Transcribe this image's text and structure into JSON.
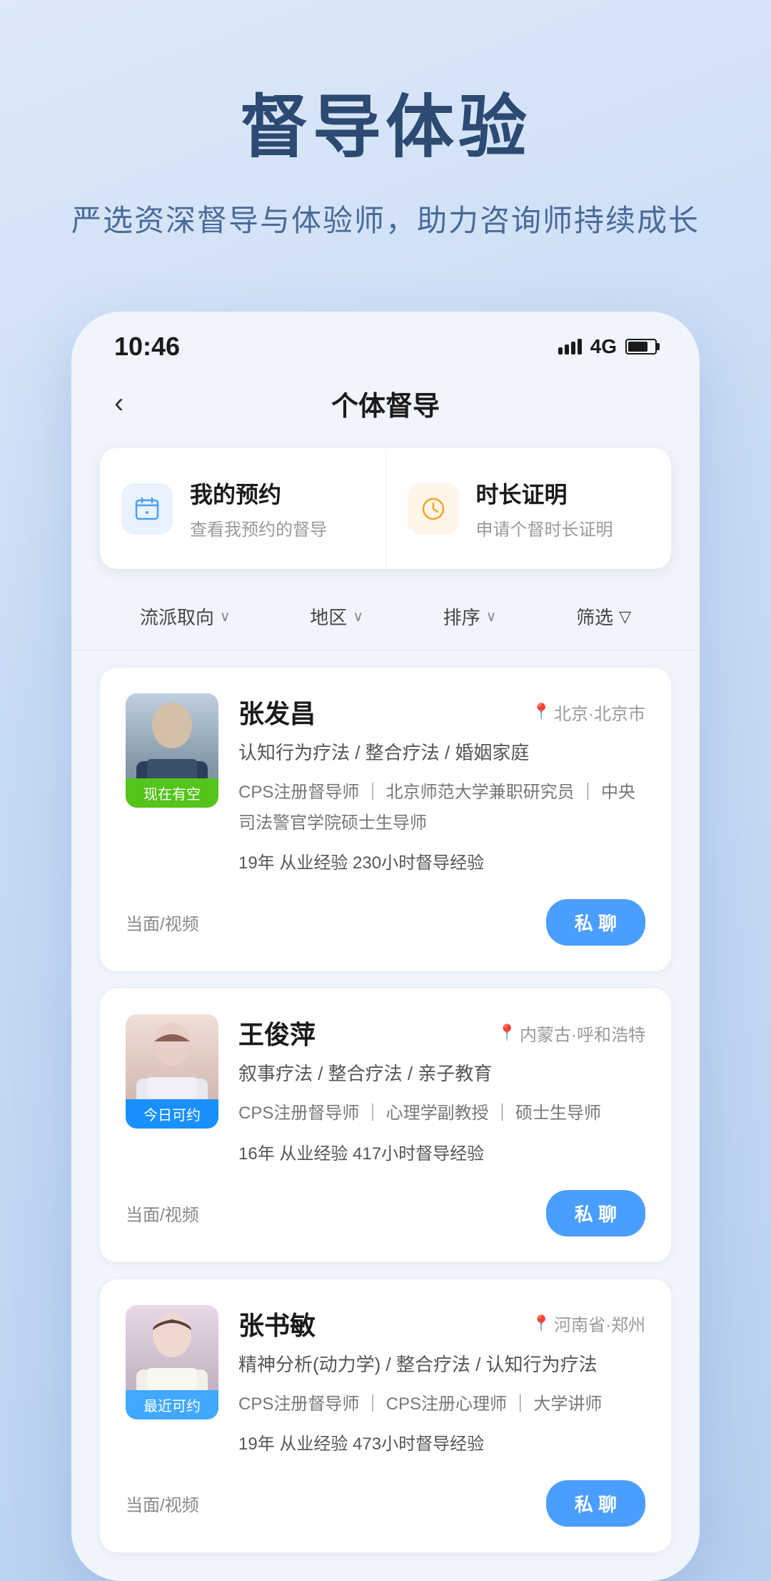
{
  "hero": {
    "title": "督导体验",
    "subtitle": "严选资深督导与体验师，助力咨询师持续成长"
  },
  "statusBar": {
    "time": "10:46",
    "signal": "4G",
    "battery": "75"
  },
  "navBar": {
    "backLabel": "‹",
    "title": "个体督导"
  },
  "actionCards": [
    {
      "id": "my-appointment",
      "icon": "📅",
      "iconType": "blue",
      "title": "我的预约",
      "desc": "查看我预约的督导"
    },
    {
      "id": "duration-cert",
      "icon": "🕐",
      "iconType": "orange",
      "title": "时长证明",
      "desc": "申请个督时长证明"
    }
  ],
  "filters": [
    {
      "label": "流派取向",
      "arrow": "∨"
    },
    {
      "label": "地区",
      "arrow": "∨"
    },
    {
      "label": "排序",
      "arrow": "∨"
    },
    {
      "label": "筛选",
      "icon": "▽"
    }
  ],
  "supervisors": [
    {
      "name": "张发昌",
      "location": "北京·北京市",
      "badge": "现在有空",
      "badgeColor": "badge-green",
      "tags": "认知行为疗法 / 整合疗法 / 婚姻家庭",
      "certs": "CPS注册督导师 ｜ 北京师范大学兼职研究员 ｜ 中央司法警官学院硕士生导师",
      "experience": "19年 从业经验   230小时督导经验",
      "mode": "当面/视频",
      "chatLabel": "私 聊",
      "avatarColor": "#8899aa"
    },
    {
      "name": "王俊萍",
      "location": "内蒙古·呼和浩特",
      "badge": "今日可约",
      "badgeColor": "badge-blue",
      "tags": "叙事疗法 / 整合疗法 / 亲子教育",
      "certs": "CPS注册督导师 ｜ 心理学副教授 ｜ 硕士生导师",
      "experience": "16年 从业经验   417小时督导经验",
      "mode": "当面/视频",
      "chatLabel": "私 聊",
      "avatarColor": "#c8a8a0"
    },
    {
      "name": "张书敏",
      "location": "河南省·郑州",
      "badge": "最近可约",
      "badgeColor": "badge-lightblue",
      "tags": "精神分析(动力学) / 整合疗法 / 认知行为疗法",
      "certs": "CPS注册督导师 ｜ CPS注册心理师 ｜ 大学讲师",
      "experience": "19年 从业经验   473小时督导经验",
      "mode": "当面/视频",
      "chatLabel": "私 聊",
      "avatarColor": "#b8a8c8"
    }
  ]
}
